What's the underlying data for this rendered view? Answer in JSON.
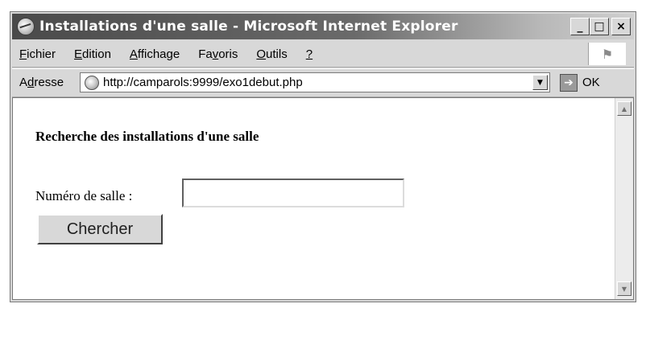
{
  "window": {
    "title": "Installations d'une salle - Microsoft Internet Explorer",
    "controls": {
      "minimize": "_",
      "maximize": "□",
      "close": "×"
    }
  },
  "menu": [
    {
      "hotkey": "F",
      "rest": "ichier"
    },
    {
      "hotkey": "E",
      "rest": "dition"
    },
    {
      "hotkey": "A",
      "rest": "ffichage"
    },
    {
      "pre": "Fa",
      "hotkey": "v",
      "rest": "oris"
    },
    {
      "hotkey": "O",
      "rest": "utils"
    },
    {
      "hotkey": "?",
      "rest": ""
    }
  ],
  "address": {
    "label_pre": "A",
    "label_hotkey": "d",
    "label_rest": "resse",
    "url": "http://camparols:9999/exo1debut.php",
    "go_label": "OK"
  },
  "page": {
    "heading": "Recherche des installations d'une salle",
    "field_label": "Numéro de salle :",
    "input_value": "",
    "button_label": "Chercher"
  },
  "icons": {
    "title": "ie-globe-icon",
    "page": "page-globe-icon",
    "dropdown": "chevron-down-icon",
    "go": "arrow-right-icon",
    "windows_logo": "windows-logo-icon"
  }
}
